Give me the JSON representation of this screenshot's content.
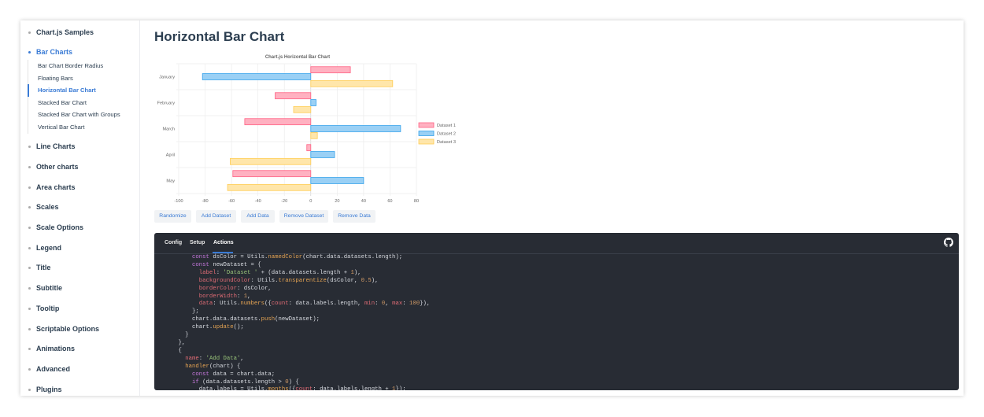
{
  "sidebar": {
    "sections": [
      {
        "label": "Chart.js Samples"
      },
      {
        "label": "Bar Charts",
        "active": true,
        "items": [
          {
            "label": "Bar Chart Border Radius"
          },
          {
            "label": "Floating Bars"
          },
          {
            "label": "Horizontal Bar Chart",
            "active": true
          },
          {
            "label": "Stacked Bar Chart"
          },
          {
            "label": "Stacked Bar Chart with Groups"
          },
          {
            "label": "Vertical Bar Chart"
          }
        ]
      },
      {
        "label": "Line Charts"
      },
      {
        "label": "Other charts"
      },
      {
        "label": "Area charts"
      },
      {
        "label": "Scales"
      },
      {
        "label": "Scale Options"
      },
      {
        "label": "Legend"
      },
      {
        "label": "Title"
      },
      {
        "label": "Subtitle"
      },
      {
        "label": "Tooltip"
      },
      {
        "label": "Scriptable Options"
      },
      {
        "label": "Animations"
      },
      {
        "label": "Advanced"
      },
      {
        "label": "Plugins"
      }
    ]
  },
  "main": {
    "title": "Horizontal Bar Chart",
    "buttons": [
      "Randomize",
      "Add Dataset",
      "Add Data",
      "Remove Dataset",
      "Remove Data"
    ]
  },
  "code_panel": {
    "tabs": [
      "Config",
      "Setup",
      "Actions"
    ],
    "active_tab": "Actions",
    "github_icon": "github-icon"
  },
  "chart_data": {
    "type": "bar",
    "orientation": "horizontal",
    "title": "Chart.js Horizontal Bar Chart",
    "categories": [
      "January",
      "February",
      "March",
      "April",
      "May"
    ],
    "series": [
      {
        "name": "Dataset 1",
        "values": [
          30,
          -27,
          -50,
          -3,
          -59
        ],
        "color": "#ff6384",
        "fill": "#ffb1c1"
      },
      {
        "name": "Dataset 2",
        "values": [
          -82,
          4,
          68,
          18,
          40
        ],
        "color": "#36a2eb",
        "fill": "#9ad0f5"
      },
      {
        "name": "Dataset 3",
        "values": [
          62,
          -13,
          5,
          -61,
          -63
        ],
        "color": "#ffcd56",
        "fill": "#ffe6aa"
      }
    ],
    "xlim": [
      -100,
      80
    ],
    "xticks": [
      "-100",
      "-80",
      "-60",
      "-40",
      "-20",
      "0",
      "20",
      "40",
      "60",
      "80"
    ],
    "grid": true,
    "legend_position": "right"
  },
  "colors": {
    "accent": "#3a7bd5",
    "code_bg": "#282c34"
  }
}
